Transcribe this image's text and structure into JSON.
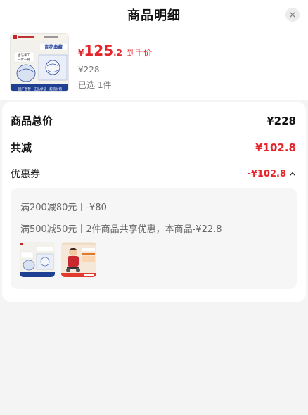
{
  "header": {
    "title": "商品明细",
    "close_icon": "close-icon"
  },
  "product": {
    "thumb_brand_text": "青花典藏",
    "thumb_tagline": "古法手工 一斧一锤",
    "thumb_footer": "国广直营 · 正品保证 · 超值价格",
    "thumb_top_text": "官方旗舰店",
    "price_symbol": "¥",
    "price_integer": "125",
    "price_decimal": ".2",
    "price_tag": "到手价",
    "original_price": "¥228",
    "selected_count": "已选 1件"
  },
  "summary": {
    "total_label": "商品总价",
    "total_value": "¥228",
    "reduce_label": "共减",
    "reduce_value": "¥102.8",
    "coupon_label": "优惠券",
    "coupon_value": "-¥102.8"
  },
  "coupon_detail": {
    "line1": "满200减80元丨-¥80",
    "line2": "满500减50元丨2件商品共享优惠，本商品-¥22.8"
  },
  "colors": {
    "accent": "#e4262c",
    "brand_blue": "#2b4aa0"
  }
}
